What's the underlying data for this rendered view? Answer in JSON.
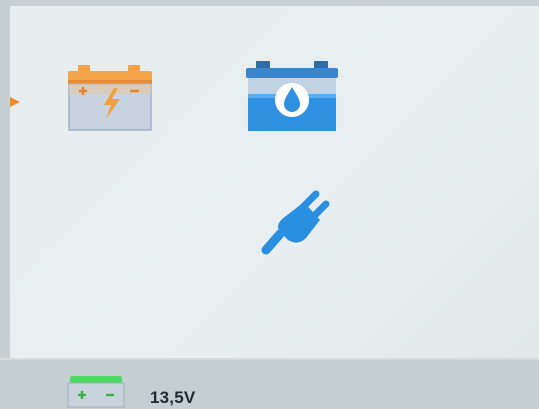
{
  "menu": {
    "items": [
      {
        "id": "battery-mode",
        "icon": "car-battery-charge-icon",
        "selected": true
      },
      {
        "id": "water-battery-mode",
        "icon": "water-battery-icon",
        "selected": false
      },
      {
        "id": "power-supply-mode",
        "icon": "power-plug-icon",
        "selected": false
      }
    ]
  },
  "status": {
    "battery_icon": "battery-terminals-icon",
    "voltage": "13,5V"
  },
  "colors": {
    "display_background": "#e8eef0",
    "orange_accent": "#f5a54a",
    "blue_accent": "#2a8fde",
    "green_status": "#4cd964",
    "text": "#1f2a33"
  }
}
